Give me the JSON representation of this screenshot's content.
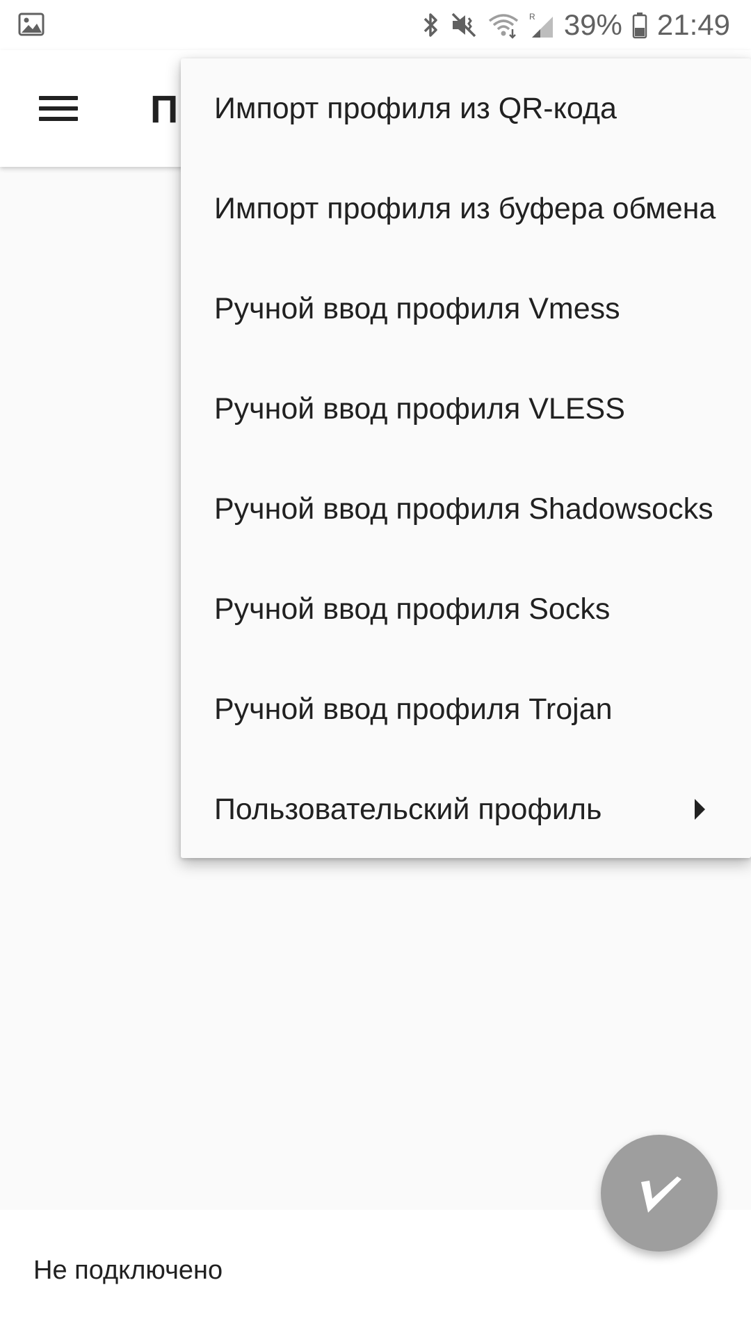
{
  "status_bar": {
    "left_icon": "image-icon",
    "icons": [
      "bluetooth-icon",
      "vibrate-mute-icon",
      "wifi-icon",
      "signal-icon",
      "battery-icon"
    ],
    "battery_percent": "39%",
    "time": "21:49"
  },
  "toolbar": {
    "menu_icon": "hamburger-menu-icon",
    "title_visible": "П"
  },
  "menu": {
    "items": [
      {
        "label": "Импорт профиля из QR-кода"
      },
      {
        "label": "Импорт профиля из буфера обмена"
      },
      {
        "label": "Ручной ввод профиля Vmess"
      },
      {
        "label": "Ручной ввод профиля VLESS"
      },
      {
        "label": "Ручной ввод профиля Shadowsocks"
      },
      {
        "label": "Ручной ввод профиля Socks"
      },
      {
        "label": "Ручной ввод профиля Trojan"
      },
      {
        "label": "Пользовательский профиль",
        "submenu_icon": "submenu-arrow-icon"
      }
    ]
  },
  "bottom": {
    "status_text": "Не подключено"
  },
  "fab": {
    "icon": "v-logo-icon",
    "color": "#9e9e9e"
  },
  "colors": {
    "background": "#fafafa",
    "surface": "#ffffff",
    "text": "#212121",
    "status_icons": "#616161"
  }
}
